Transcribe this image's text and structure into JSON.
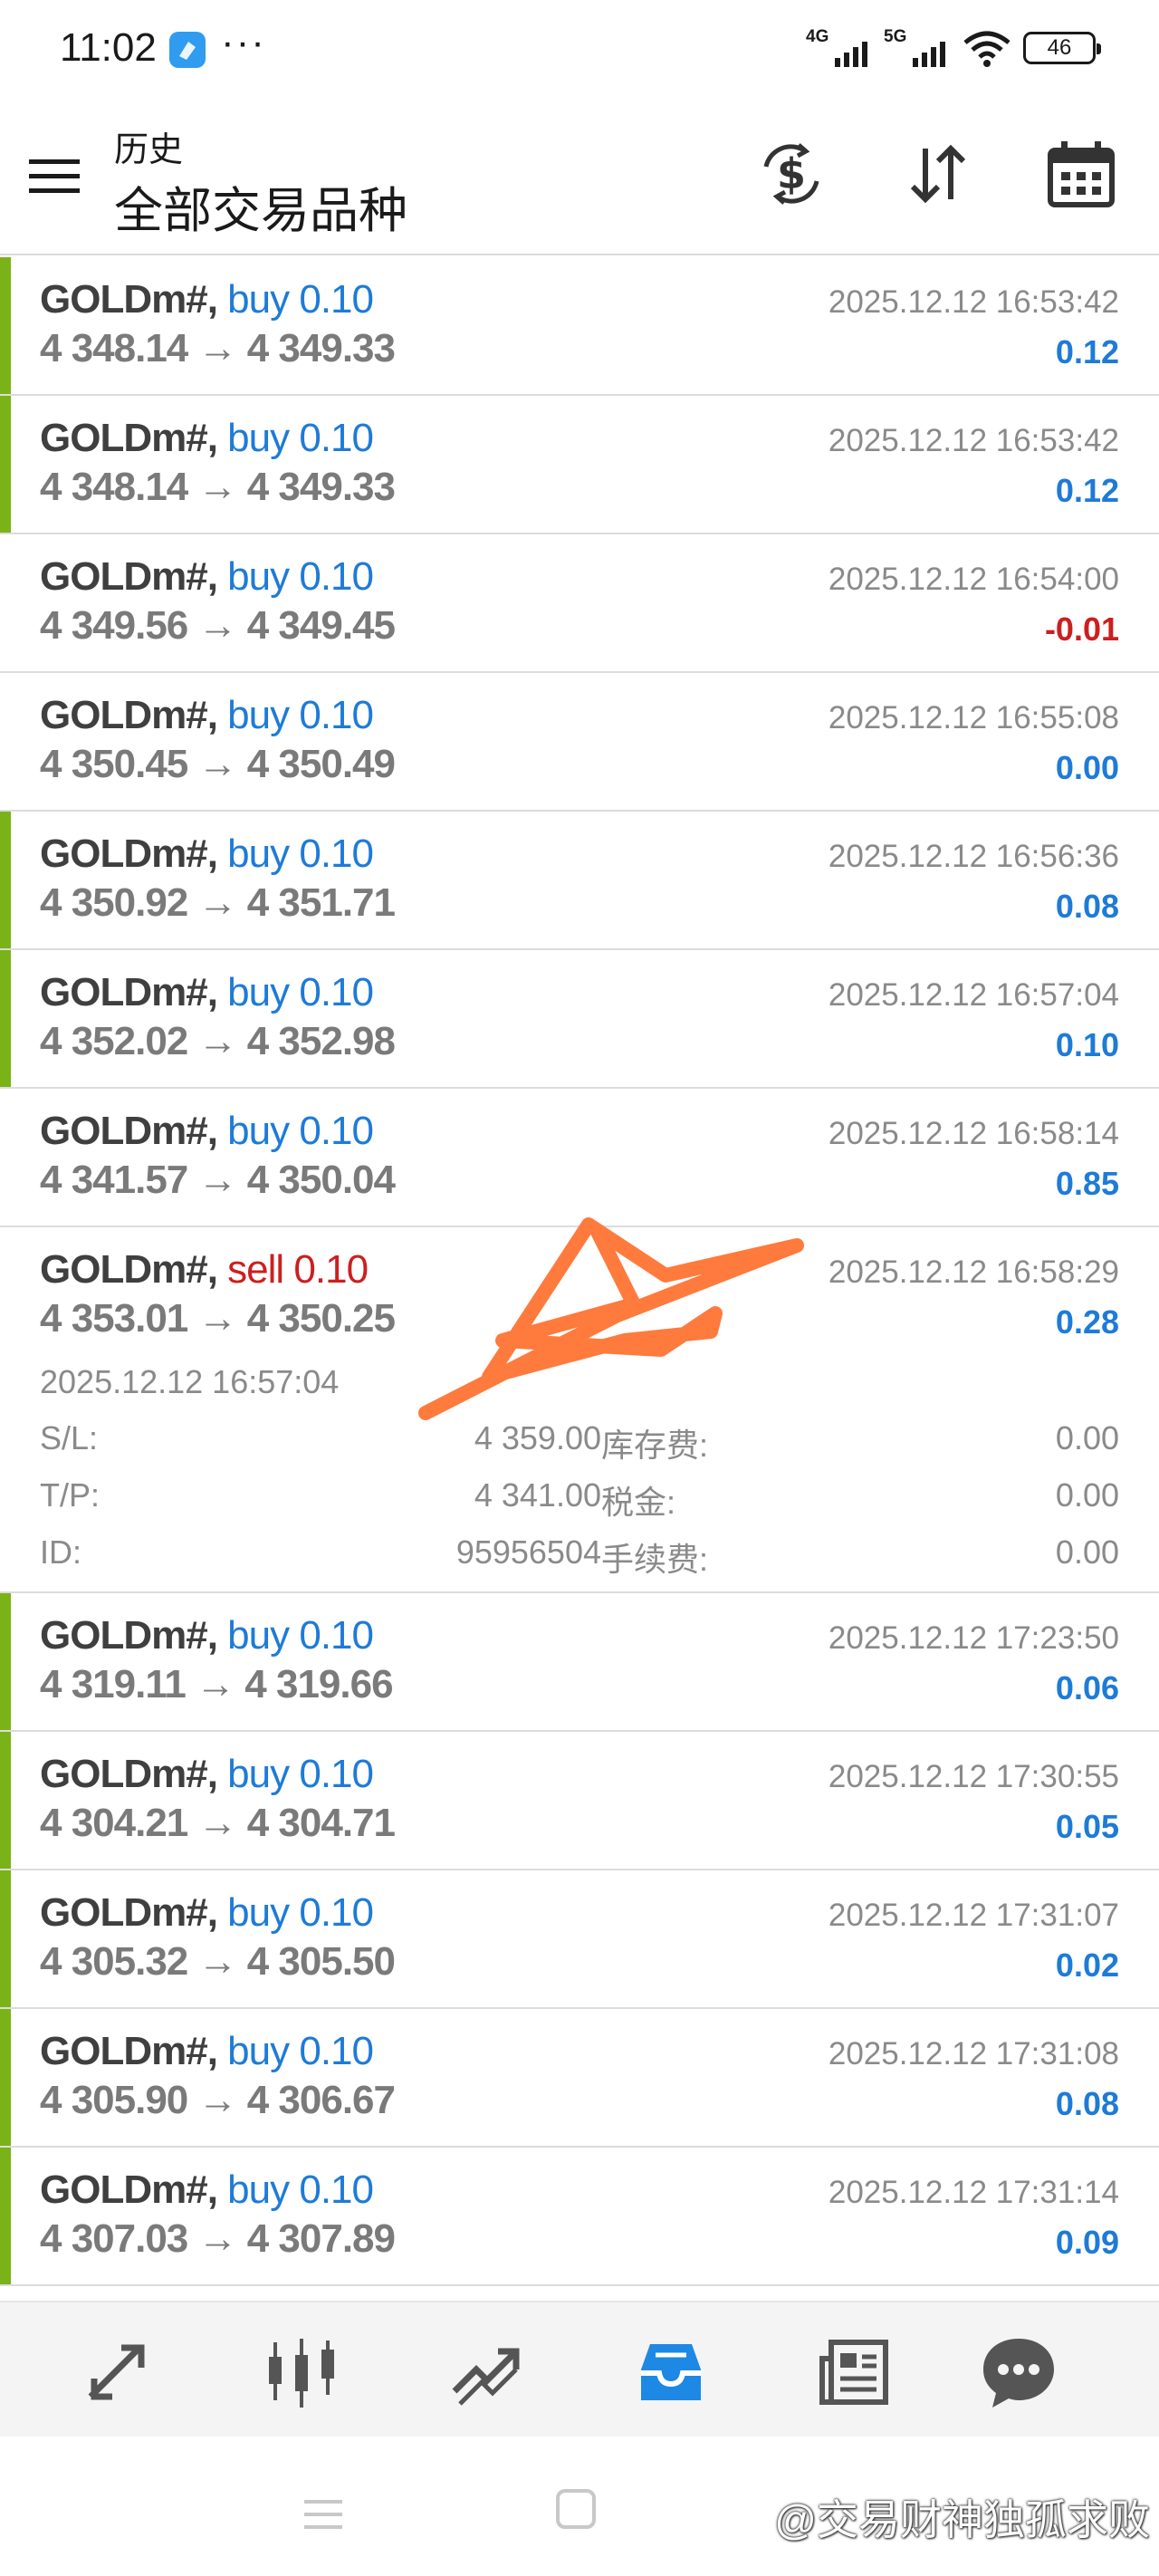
{
  "status_bar": {
    "time": "11:02",
    "dots": "···",
    "net1": "4G",
    "net2": "5G",
    "battery": "46"
  },
  "toolbar": {
    "subtitle": "历史",
    "title": "全部交易品种",
    "buttons": [
      "currency-exchange-icon",
      "sort-icon",
      "calendar-icon"
    ]
  },
  "trades": [
    {
      "symbol": "GOLDm#,",
      "side": "buy",
      "volume": "0.10",
      "prices": "4 348.14 → 4 349.33",
      "time": "2025.12.12 16:53:42",
      "profit": "0.12"
    },
    {
      "symbol": "GOLDm#,",
      "side": "buy",
      "volume": "0.10",
      "prices": "4 348.14 → 4 349.33",
      "time": "2025.12.12 16:53:42",
      "profit": "0.12"
    },
    {
      "symbol": "GOLDm#,",
      "side": "buy",
      "volume": "0.10",
      "prices": "4 349.56 → 4 349.45",
      "time": "2025.12.12 16:54:00",
      "profit": "-0.01"
    },
    {
      "symbol": "GOLDm#,",
      "side": "buy",
      "volume": "0.10",
      "prices": "4 350.45 → 4 350.49",
      "time": "2025.12.12 16:55:08",
      "profit": "0.00"
    },
    {
      "symbol": "GOLDm#,",
      "side": "buy",
      "volume": "0.10",
      "prices": "4 350.92 → 4 351.71",
      "time": "2025.12.12 16:56:36",
      "profit": "0.08"
    },
    {
      "symbol": "GOLDm#,",
      "side": "buy",
      "volume": "0.10",
      "prices": "4 352.02 → 4 352.98",
      "time": "2025.12.12 16:57:04",
      "profit": "0.10"
    },
    {
      "symbol": "GOLDm#,",
      "side": "buy",
      "volume": "0.10",
      "prices": "4 341.57 → 4 350.04",
      "time": "2025.12.12 16:58:14",
      "profit": "0.85"
    },
    {
      "symbol": "GOLDm#,",
      "side": "sell",
      "volume": "0.10",
      "prices": "4 353.01 → 4 350.25",
      "time": "2025.12.12 16:58:29",
      "profit": "0.28"
    },
    {
      "symbol": "GOLDm#,",
      "side": "buy",
      "volume": "0.10",
      "prices": "4 319.11 → 4 319.66",
      "time": "2025.12.12 17:23:50",
      "profit": "0.06"
    },
    {
      "symbol": "GOLDm#,",
      "side": "buy",
      "volume": "0.10",
      "prices": "4 304.21 → 4 304.71",
      "time": "2025.12.12 17:30:55",
      "profit": "0.05"
    },
    {
      "symbol": "GOLDm#,",
      "side": "buy",
      "volume": "0.10",
      "prices": "4 305.32 → 4 305.50",
      "time": "2025.12.12 17:31:07",
      "profit": "0.02"
    },
    {
      "symbol": "GOLDm#,",
      "side": "buy",
      "volume": "0.10",
      "prices": "4 305.90 → 4 306.67",
      "time": "2025.12.12 17:31:08",
      "profit": "0.08"
    },
    {
      "symbol": "GOLDm#,",
      "side": "buy",
      "volume": "0.10",
      "prices": "4 307.03 → 4 307.89",
      "time": "2025.12.12 17:31:14",
      "profit": "0.09"
    }
  ],
  "expanded_detail": {
    "open_time": "2025.12.12 16:57:04",
    "sl_label": "S/L:",
    "sl_value": "4 359.00",
    "tp_label": "T/P:",
    "tp_value": "4 341.00",
    "id_label": "ID:",
    "id_value": "95956504",
    "swap_label": "库存费:",
    "swap_value": "0.00",
    "tax_label": "税金:",
    "tax_value": "0.00",
    "fee_label": "手续费:",
    "fee_value": "0.00"
  },
  "bottom_nav": [
    "quotes-icon",
    "chart-icon",
    "trade-icon",
    "history-icon",
    "news-icon",
    "chat-icon"
  ],
  "watermark": "@交易财神独孤求败",
  "colors": {
    "buy": "#1e7bd7",
    "sell": "#cc1f1f",
    "profit_bar": "#7ab317",
    "active_nav": "#1e88e5",
    "scribble": "#ff7a3d"
  }
}
